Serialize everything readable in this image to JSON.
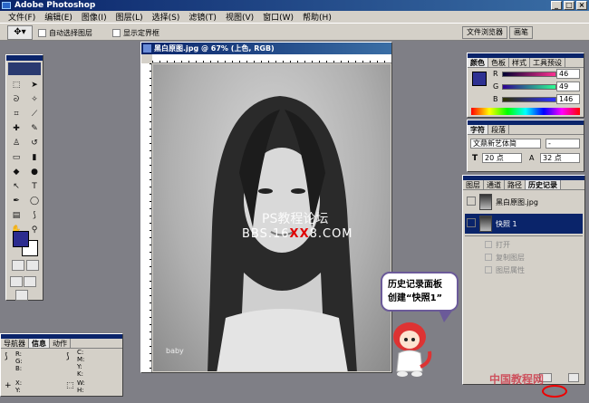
{
  "window": {
    "title": "Adobe Photoshop",
    "controls": [
      "_",
      "□",
      "×"
    ]
  },
  "menu": [
    "文件(F)",
    "编辑(E)",
    "图像(I)",
    "图层(L)",
    "选择(S)",
    "滤镜(T)",
    "视图(V)",
    "窗口(W)",
    "帮助(H)"
  ],
  "options": {
    "auto_select": "自动选择图层",
    "show_bounds": "显示定界框"
  },
  "top_wells": {
    "file_browser": "文件浏览器",
    "brushes": "画笔"
  },
  "document": {
    "title": "黑白原图.jpg @ 67% (上色, RGB)",
    "watermark_1": "PS教程论坛",
    "watermark_2a": "BBS.16",
    "watermark_2b": "XX",
    "watermark_2c": "8.COM",
    "badge": "baby"
  },
  "color_panel": {
    "tabs": [
      "颜色",
      "色板",
      "样式",
      "工具预设"
    ],
    "r_label": "R",
    "g_label": "G",
    "b_label": "B",
    "r": "46",
    "g": "49",
    "b": "146",
    "fg_color": "#2e3192"
  },
  "char_panel": {
    "tabs": [
      "字符",
      "段落"
    ],
    "font": "文鼎新艺体简",
    "style": "-",
    "size": "20 点",
    "leading": "32 点"
  },
  "history_panel": {
    "tabs": [
      "图层",
      "通道",
      "路径",
      "历史记录"
    ],
    "snapshots": [
      {
        "label": "黑白原图.jpg"
      },
      {
        "label": "快照 1"
      }
    ],
    "steps": [
      "打开",
      "复制图层",
      "图层属性"
    ]
  },
  "nav_panel": {
    "tabs": [
      "导航器",
      "信息",
      "动作"
    ],
    "info": {
      "rgb": "R:\nG:\nB:",
      "cmyk": "C:\nM:\nY:\nK:",
      "xy": "X:\nY:",
      "wh": "W:\nH:"
    }
  },
  "callout": {
    "line1": "历史记录面板",
    "line2": "创建“快照1”"
  },
  "footer_logo": "中国教程网"
}
